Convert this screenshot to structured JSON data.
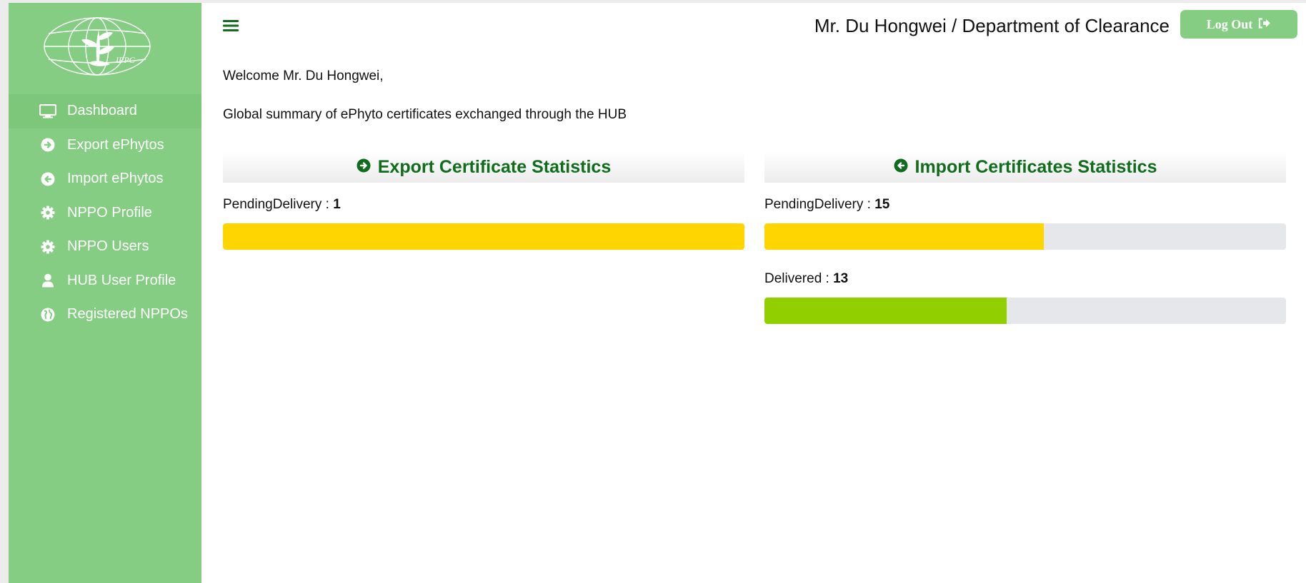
{
  "sidebar": {
    "logo_text": "IPPC",
    "items": [
      {
        "label": "Dashboard",
        "icon": "monitor-icon"
      },
      {
        "label": "Export ePhytos",
        "icon": "circle-arrow-right-icon"
      },
      {
        "label": "Import ePhytos",
        "icon": "circle-arrow-left-icon"
      },
      {
        "label": "NPPO Profile",
        "icon": "gear-icon"
      },
      {
        "label": "NPPO Users",
        "icon": "gear-icon"
      },
      {
        "label": "HUB User Profile",
        "icon": "user-icon"
      },
      {
        "label": "Registered NPPOs",
        "icon": "globe-icon"
      }
    ]
  },
  "header": {
    "user_title": "Mr. Du Hongwei / Department of Clearance",
    "logout_label": "Log Out"
  },
  "main": {
    "welcome": "Welcome Mr. Du Hongwei,",
    "summary": "Global summary of ePhyto certificates exchanged through the HUB",
    "export": {
      "title": "Export Certificate Statistics",
      "stats": [
        {
          "label": "PendingDelivery : ",
          "value": "1",
          "fill": 1.0,
          "color": "#ffd500"
        }
      ]
    },
    "import": {
      "title": "Import Certificates Statistics",
      "stats": [
        {
          "label": "PendingDelivery : ",
          "value": "15",
          "fill": 0.536,
          "color": "#ffd500"
        },
        {
          "label": "Delivered : ",
          "value": "13",
          "fill": 0.464,
          "color": "#92cf00"
        }
      ]
    }
  },
  "colors": {
    "sidebar": "#86cd84",
    "heading": "#0f6d1c",
    "pending": "#ffd500",
    "delivered": "#92cf00",
    "track": "#e6e7ea"
  }
}
